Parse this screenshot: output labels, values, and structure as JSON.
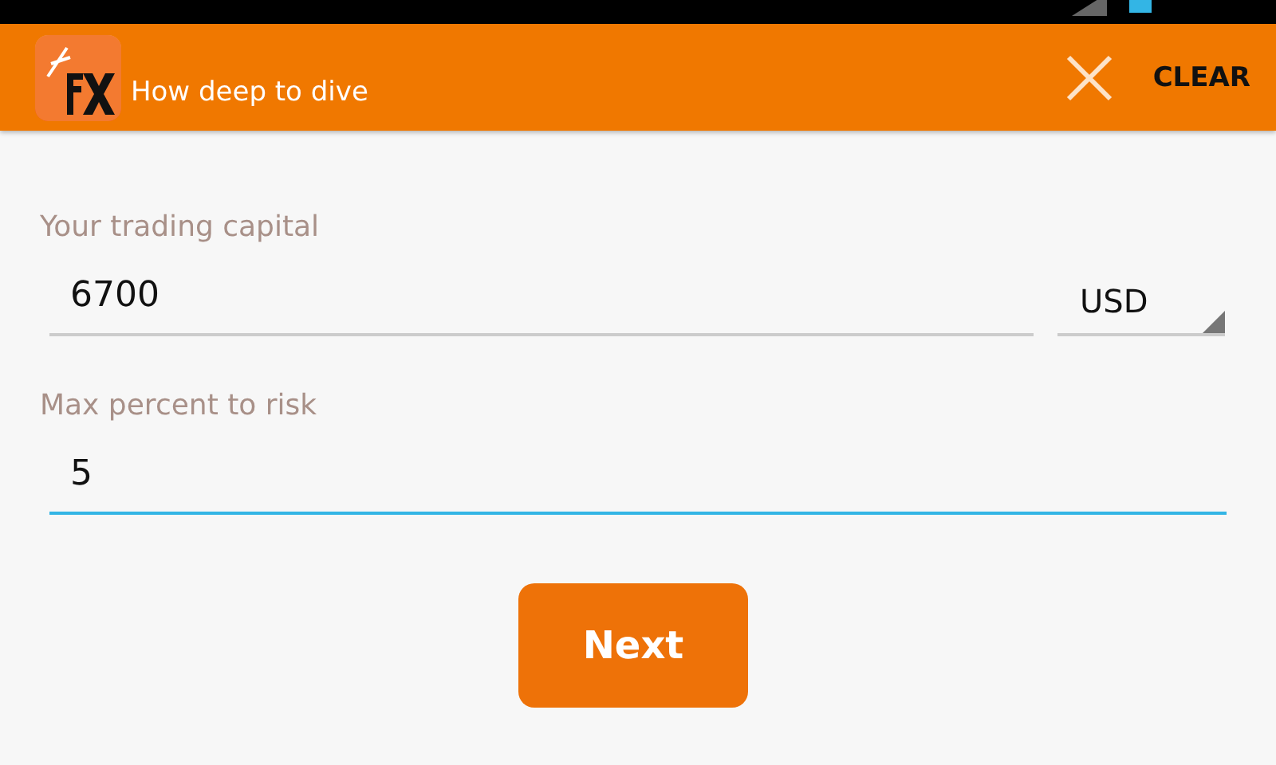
{
  "action_bar": {
    "title": "How deep to dive",
    "clear_label": "CLEAR"
  },
  "fields": [
    {
      "label": "Your trading capital",
      "value": "6700",
      "focused": false,
      "currency": "USD"
    },
    {
      "label": "Max percent to risk",
      "value": "5",
      "focused": true
    }
  ],
  "next_button": "Next"
}
